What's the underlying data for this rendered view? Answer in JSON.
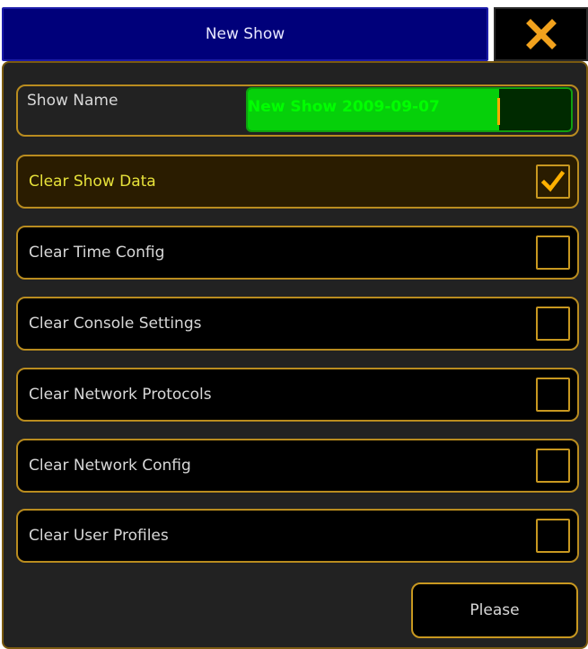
{
  "window": {
    "title": "New Show"
  },
  "close_icon": "close-x-icon",
  "colors": {
    "title_bg": "#00007a",
    "accent": "#c89820",
    "active_text": "#e7e23a",
    "selection": "#06d00a"
  },
  "show_name": {
    "label": "Show Name",
    "value": "New Show 2009-09-07"
  },
  "options": [
    {
      "label": "Clear Show Data",
      "checked": true
    },
    {
      "label": "Clear Time Config",
      "checked": false
    },
    {
      "label": "Clear Console Settings",
      "checked": false
    },
    {
      "label": "Clear Network Protocols",
      "checked": false
    },
    {
      "label": "Clear Network Config",
      "checked": false
    },
    {
      "label": "Clear User Profiles",
      "checked": false
    }
  ],
  "confirm_button": {
    "label": "Please"
  }
}
